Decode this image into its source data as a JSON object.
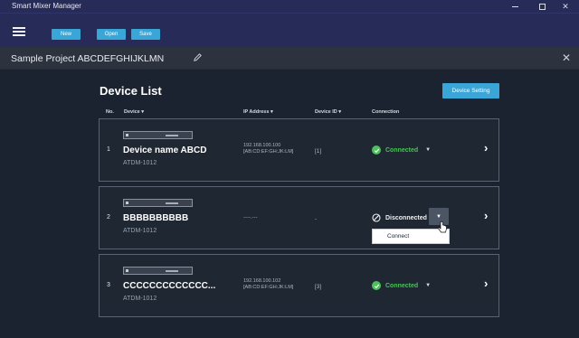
{
  "window": {
    "title": "Smart Mixer Manager",
    "controls": [
      "minimize",
      "maximize",
      "close"
    ]
  },
  "toolbar": {
    "menu_icon": "hamburger-icon",
    "new_label": "New",
    "open_label": "Open",
    "save_label": "Save"
  },
  "project": {
    "title": "Sample Project ABCDEFGHIJKLMN",
    "edit_icon": "pencil-icon",
    "close_icon": "close-icon"
  },
  "device_list": {
    "title": "Device List",
    "setting_button": "Device Setting",
    "columns": {
      "no": "No.",
      "device": "Device ▾",
      "ip": "IP Address ▾",
      "device_id": "Device ID ▾",
      "connection": "Connection"
    },
    "rows": [
      {
        "no": "1",
        "name": "Device name ABCD",
        "model": "ATDM-1012",
        "ip_line1": "192.168.100.100",
        "ip_line2": "[AB:CD:EF:GH:JK:LM]",
        "device_id": "[1]",
        "status": "Connected",
        "status_color": "#4cc05a"
      },
      {
        "no": "2",
        "name": "BBBBBBBBBB",
        "model": "ATDM-1012",
        "ip_placeholder": "----.---",
        "device_id": "-",
        "status": "Disconnected"
      },
      {
        "no": "3",
        "name": "CCCCCCCCCCCCC...",
        "model": "ATDM-1012",
        "ip_line1": "192.168.100.102",
        "ip_line2": "[AB:CD:EF:GH:JK:LM]",
        "device_id": "[3]",
        "status": "Connected",
        "status_color": "#4cc05a"
      }
    ],
    "dropdown": {
      "open_for_row": "2",
      "items": [
        "Connect"
      ]
    }
  },
  "colors": {
    "accent": "#3aa6d8",
    "titlebar": "#262b57",
    "background": "#1b2330",
    "connected": "#4cc05a"
  }
}
